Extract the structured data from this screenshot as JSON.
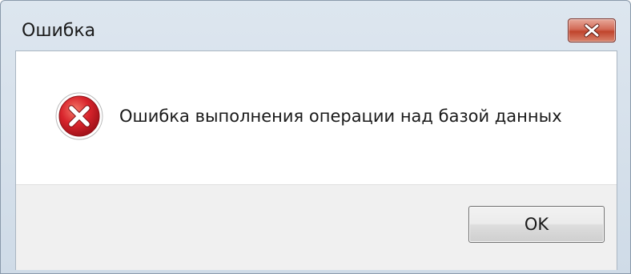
{
  "window": {
    "title": "Ошибка"
  },
  "title_bar": {
    "close_icon": "close-icon"
  },
  "message": {
    "icon": "error-icon",
    "text": "Ошибка выполнения операции над базой данных"
  },
  "buttons": {
    "ok_label": "OK"
  },
  "colors": {
    "error_red": "#d8242c",
    "close_button_red": "#c7472f",
    "frame": "#cfdbe7",
    "footer": "#f0f0f0"
  }
}
